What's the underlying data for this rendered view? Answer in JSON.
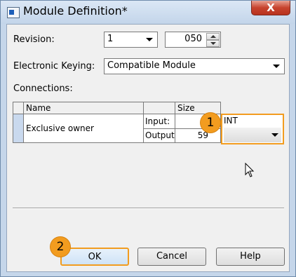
{
  "window": {
    "title": "Module Definition*",
    "close_label": "X"
  },
  "form": {
    "revision_label": "Revision:",
    "revision_major": "1",
    "revision_minor": "050",
    "keying_label": "Electronic Keying:",
    "keying_value": "Compatible Module",
    "connections_label": "Connections:"
  },
  "connections_table": {
    "headers": {
      "name": "Name",
      "size": "Size"
    },
    "rows": [
      {
        "name": "Exclusive owner",
        "input_label": "Input:",
        "input_size": "5",
        "output_label": "Output",
        "output_size": "59",
        "data_type": "INT"
      }
    ]
  },
  "badges": {
    "step1": "1",
    "step2": "2"
  },
  "buttons": {
    "ok": "OK",
    "cancel": "Cancel",
    "help": "Help"
  },
  "colors": {
    "badge": "#f29c1f",
    "highlight_border": "#f29c1f"
  }
}
